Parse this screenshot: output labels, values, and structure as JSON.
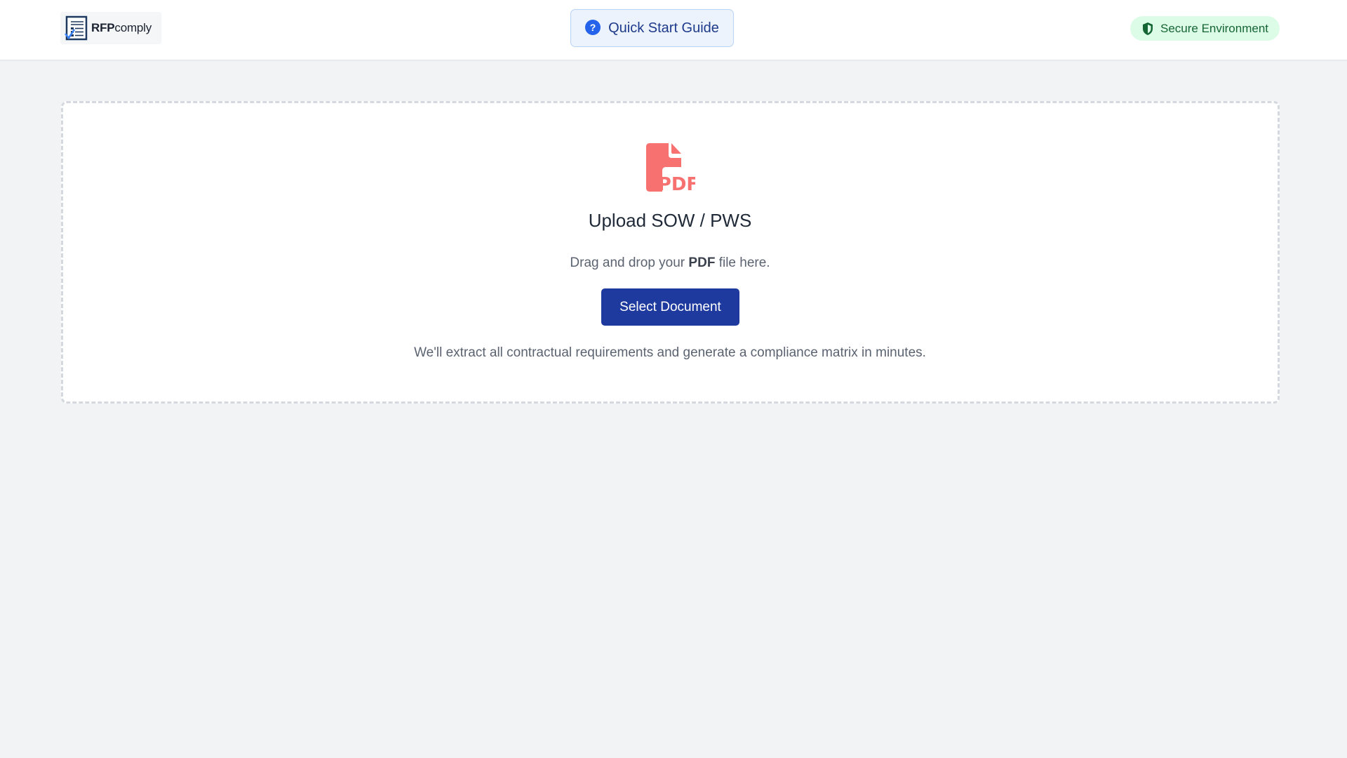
{
  "header": {
    "logo": {
      "bold": "RFP",
      "regular": "comply",
      "icon": "checklist-document-icon"
    },
    "guide_button": {
      "label": "Quick Start Guide",
      "icon": "question-circle-icon",
      "icon_glyph": "?"
    },
    "secure_badge": {
      "label": "Secure Environment",
      "icon": "shield-icon"
    }
  },
  "upload": {
    "icon": "pdf-file-icon",
    "icon_text": "PDF",
    "title": "Upload SOW / PWS",
    "drag_prefix": "Drag and drop your ",
    "drag_bold": "PDF",
    "drag_suffix": " file here.",
    "button_label": "Select Document",
    "note": "We'll extract all contractual requirements and generate a compliance matrix in minutes."
  },
  "colors": {
    "accent": "#1e3a9e",
    "pdf_icon": "#f87171",
    "secure_bg": "#dcfce7",
    "secure_text": "#166534",
    "guide_bg": "#ecf3fd"
  }
}
